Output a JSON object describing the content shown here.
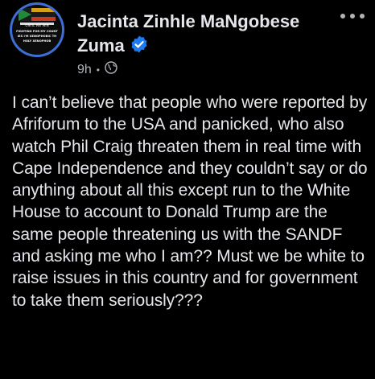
{
  "post": {
    "author": {
      "name": "Jacinta Zinhle MaNgobese Zuma",
      "verified_icon": "verified-badge-icon",
      "avatar_text": [
        "ONTIL WE WIN",
        "FIGHTING FOR MY COUNT",
        "IES I'M XENOPHOBIC TH",
        "HOLY XENOPHOB"
      ]
    },
    "meta": {
      "time": "9h",
      "separator": "•",
      "audience_icon": "globe-icon"
    },
    "more_icon": "more-options-icon",
    "text": "I can’t believe that people who were reported by Afriforum to the USA and panicked, who also watch Phil Craig threaten them in real time with Cape Independence and they couldn’t say or do anything about all this except run to the White House to account to Donald Trump are the same people threatening us with the SANDF and asking me who I am?? Must we be white to raise issues in this country and for government to take them seriously???"
  },
  "colors": {
    "background": "#000000",
    "primary_text": "#e4e6eb",
    "secondary_text": "#b0b3b8",
    "verified_blue": "#1d7bf2",
    "avatar_ring": "#3d6fd6"
  }
}
